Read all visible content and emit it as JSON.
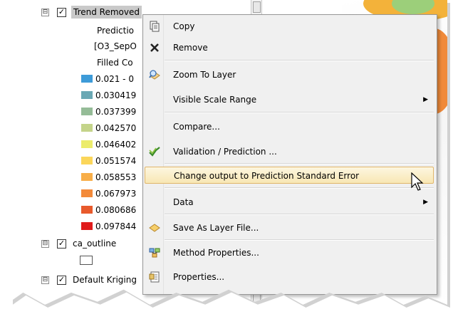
{
  "toc": {
    "layer1": {
      "name": "Trend Removed",
      "sub1": "Predictio",
      "sub2": "[O3_SepO",
      "sub3": "Filled Co"
    },
    "classes": [
      {
        "label": "0.021 - 0",
        "color": "#3d9bd8"
      },
      {
        "label": "0.030419",
        "color": "#6aa8b4"
      },
      {
        "label": "0.037399",
        "color": "#95bc97"
      },
      {
        "label": "0.042570",
        "color": "#c4d48a"
      },
      {
        "label": "0.046402",
        "color": "#ecec6b"
      },
      {
        "label": "0.051574",
        "color": "#fbd65a"
      },
      {
        "label": "0.058553",
        "color": "#f8ae48"
      },
      {
        "label": "0.067973",
        "color": "#f38a3a"
      },
      {
        "label": "0.080686",
        "color": "#e85a2c"
      },
      {
        "label": "0.097844",
        "color": "#e01c1c"
      }
    ],
    "layer2": {
      "name": "ca_outline"
    },
    "layer3": {
      "name": "Default Kriging"
    }
  },
  "menu": {
    "items": [
      {
        "label": "Copy",
        "icon": "copy-icon"
      },
      {
        "label": "Remove",
        "icon": "remove-x-icon"
      },
      {
        "label": "Zoom To Layer",
        "icon": "zoom-to-layer-icon"
      },
      {
        "label": "Visible Scale Range",
        "icon": "",
        "submenu": true
      },
      {
        "label": "Compare...",
        "icon": ""
      },
      {
        "label": "Validation / Prediction ...",
        "icon": "validation-icon"
      },
      {
        "label": "Change output to Prediction Standard Error",
        "icon": "",
        "active": true
      },
      {
        "label": "Data",
        "icon": "",
        "submenu": true
      },
      {
        "label": "Save As Layer File...",
        "icon": "layer-file-icon"
      },
      {
        "label": "Method Properties...",
        "icon": "method-properties-icon"
      },
      {
        "label": "Properties...",
        "icon": "properties-icon"
      }
    ]
  },
  "symbols": {
    "expander": "⊟",
    "check": "✓",
    "submenu_arrow": "▶"
  }
}
